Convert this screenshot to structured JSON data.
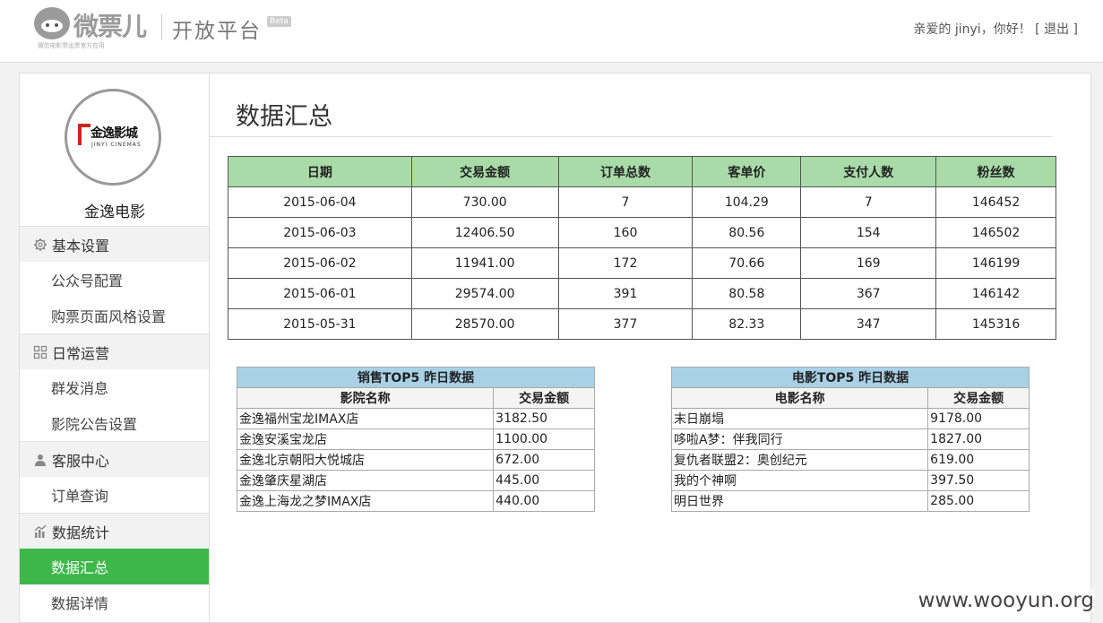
{
  "header": {
    "logo_text": "微票儿",
    "logo_tagline": "微信电影票出票官方应用",
    "platform_title": "开放平台",
    "beta_badge": "Beta",
    "greeting": "亲爱的 jinyi，你好！",
    "bracket_open": "[",
    "logout_label": "退出",
    "bracket_close": "]"
  },
  "sidebar": {
    "brand_cn": "金逸影城",
    "brand_en": "JINYI CINEMAS",
    "cinema_name": "金逸电影",
    "groups": [
      {
        "label": "基本设置",
        "icon": "gear-icon",
        "items": [
          {
            "label": "公众号配置"
          },
          {
            "label": "购票页面风格设置"
          }
        ]
      },
      {
        "label": "日常运营",
        "icon": "grid-icon",
        "items": [
          {
            "label": "群发消息"
          },
          {
            "label": "影院公告设置"
          }
        ]
      },
      {
        "label": "客服中心",
        "icon": "user-icon",
        "items": [
          {
            "label": "订单查询"
          }
        ]
      },
      {
        "label": "数据统计",
        "icon": "chart-icon",
        "items": [
          {
            "label": "数据汇总",
            "active": true
          },
          {
            "label": "数据详情"
          }
        ]
      }
    ]
  },
  "main": {
    "page_title": "数据汇总",
    "summary_table": {
      "headers": [
        "日期",
        "交易金额",
        "订单总数",
        "客单价",
        "支付人数",
        "粉丝数"
      ],
      "rows": [
        [
          "2015-06-04",
          "730.00",
          "7",
          "104.29",
          "7",
          "146452"
        ],
        [
          "2015-06-03",
          "12406.50",
          "160",
          "80.56",
          "154",
          "146502"
        ],
        [
          "2015-06-02",
          "11941.00",
          "172",
          "70.66",
          "169",
          "146199"
        ],
        [
          "2015-06-01",
          "29574.00",
          "391",
          "80.58",
          "367",
          "146142"
        ],
        [
          "2015-05-31",
          "28570.00",
          "377",
          "82.33",
          "347",
          "145316"
        ]
      ]
    },
    "sales_top5": {
      "caption": "销售TOP5 昨日数据",
      "headers": [
        "影院名称",
        "交易金额"
      ],
      "rows": [
        [
          "金逸福州宝龙IMAX店",
          "3182.50"
        ],
        [
          "金逸安溪宝龙店",
          "1100.00"
        ],
        [
          "金逸北京朝阳大悦城店",
          "672.00"
        ],
        [
          "金逸肇庆星湖店",
          "445.00"
        ],
        [
          "金逸上海龙之梦IMAX店",
          "440.00"
        ]
      ]
    },
    "movie_top5": {
      "caption": "电影TOP5 昨日数据",
      "headers": [
        "电影名称",
        "交易金额"
      ],
      "rows": [
        [
          "末日崩塌",
          "9178.00"
        ],
        [
          "哆啦A梦：伴我同行",
          "1827.00"
        ],
        [
          "复仇者联盟2：奥创纪元",
          "619.00"
        ],
        [
          "我的个神啊",
          "397.50"
        ],
        [
          "明日世界",
          "285.00"
        ]
      ]
    }
  },
  "watermark": "www.wooyun.org",
  "colors": {
    "accent_green": "#3cb84a",
    "table_header_green": "#a8dba8",
    "top5_caption_blue": "#a8d1e6"
  }
}
